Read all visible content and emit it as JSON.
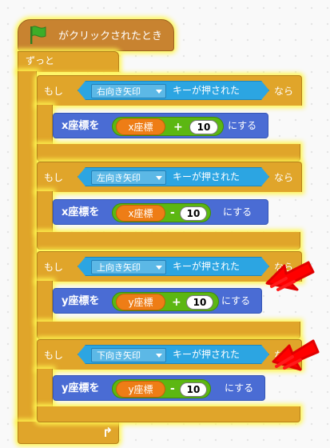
{
  "event_block": {
    "label": "がクリックされたとき",
    "flag_color": "#3dad28"
  },
  "forever_block": {
    "label": "ずっと",
    "end_arrow": "↱"
  },
  "if_label": "もし",
  "then_label": "なら",
  "key_pressed_label": "キーが押された",
  "set_suffix": "にする",
  "if_blocks": [
    {
      "key": "右向き矢印",
      "set_label": "x座標を",
      "var": "x座標",
      "op": "+",
      "value": "10"
    },
    {
      "key": "左向き矢印",
      "set_label": "x座標を",
      "var": "x座標",
      "op": "-",
      "value": "10"
    },
    {
      "key": "上向き矢印",
      "set_label": "y座標を",
      "var": "y座標",
      "op": "+",
      "value": "10"
    },
    {
      "key": "下向き矢印",
      "set_label": "y座標を",
      "var": "y座標",
      "op": "-",
      "value": "10"
    }
  ],
  "colors": {
    "control": "#e0a52a",
    "event": "#c88330",
    "motion": "#4a6cd4",
    "sensing": "#2ca5e2",
    "operator": "#5cb712",
    "variable": "#ee7d16",
    "annotation_arrow": "#ff0000",
    "glow": "#fff550"
  },
  "annotations": [
    "red-arrow-pointing-at-up-key-block",
    "red-arrow-pointing-at-down-key-block"
  ]
}
